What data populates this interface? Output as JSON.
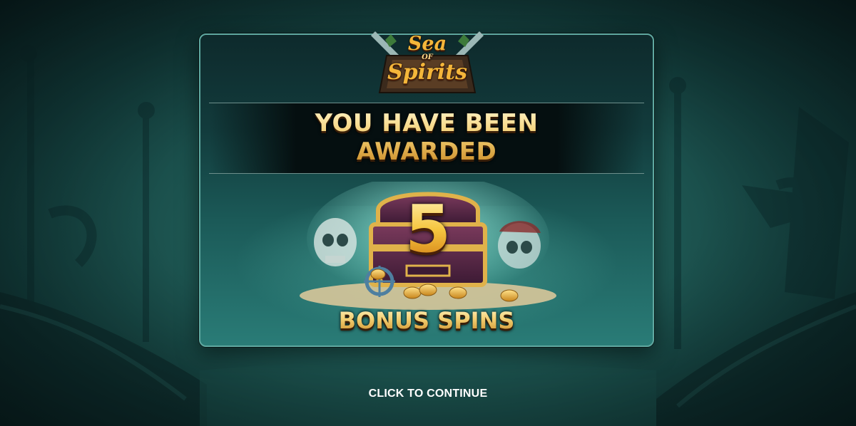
{
  "game": {
    "logo": {
      "line1": "Sea",
      "line2": "OF",
      "line3": "Spirits"
    }
  },
  "award": {
    "headline_line1": "YOU HAVE BEEN",
    "headline_line2": "AWARDED",
    "count": "5",
    "prize_label": "BONUS SPINS"
  },
  "footer": {
    "continue_label": "CLICK TO CONTINUE"
  },
  "colors": {
    "gold_text": "#f3cf72",
    "panel_border": "#5fa8a0",
    "background_teal": "#1f5a55"
  },
  "icons": [
    "crossed-swords-icon",
    "treasure-chest-icon",
    "skull-icon",
    "ship-wheel-icon",
    "gold-coin-icon"
  ]
}
